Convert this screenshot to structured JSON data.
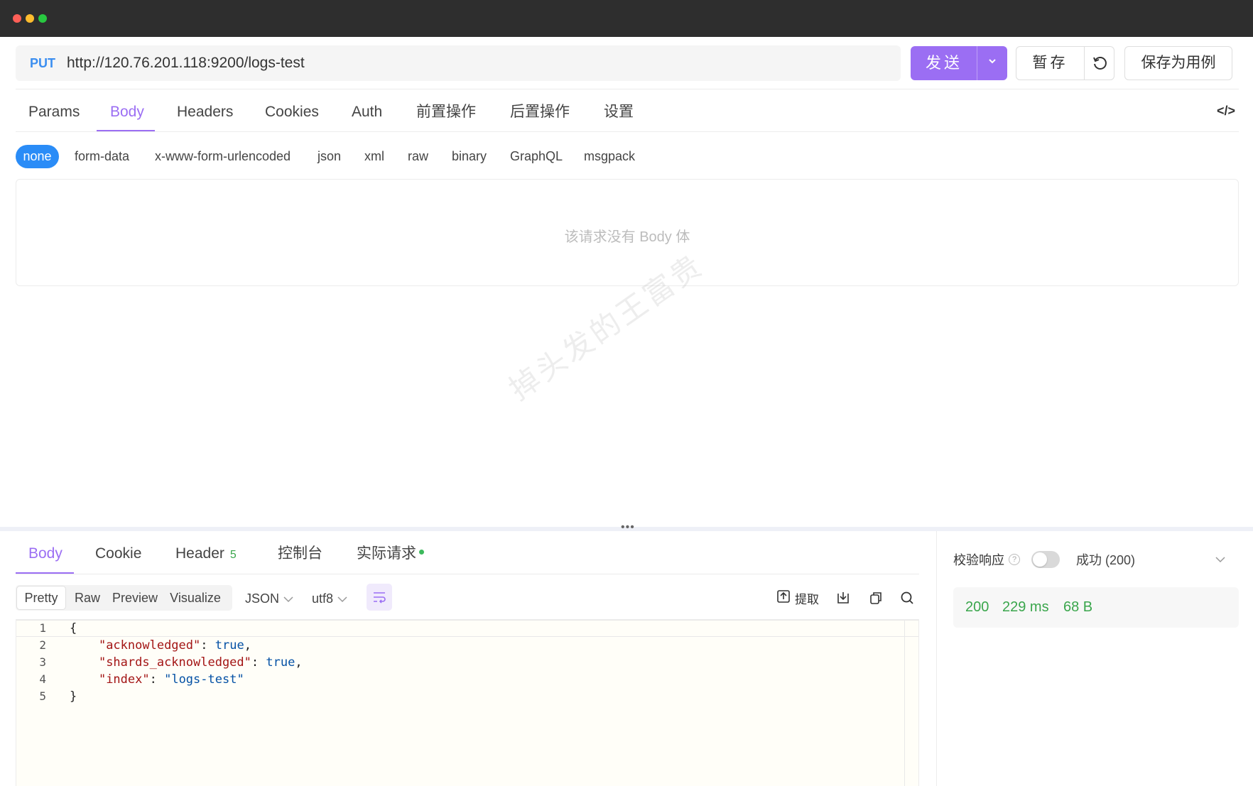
{
  "request": {
    "method": "PUT",
    "url": "http://120.76.201.118:9200/logs-test",
    "send_label": "发送",
    "save_temp_label": "暂存",
    "save_case_label": "保存为用例"
  },
  "request_tabs": [
    {
      "label": "Params"
    },
    {
      "label": "Body"
    },
    {
      "label": "Headers"
    },
    {
      "label": "Cookies"
    },
    {
      "label": "Auth"
    },
    {
      "label": "前置操作"
    },
    {
      "label": "后置操作"
    },
    {
      "label": "设置"
    }
  ],
  "code_icon": "</>",
  "body_types": [
    {
      "label": "none"
    },
    {
      "label": "form-data"
    },
    {
      "label": "x-www-form-urlencoded"
    },
    {
      "label": "json"
    },
    {
      "label": "xml"
    },
    {
      "label": "raw"
    },
    {
      "label": "binary"
    },
    {
      "label": "GraphQL"
    },
    {
      "label": "msgpack"
    }
  ],
  "body_empty_text": "该请求没有 Body 体",
  "watermark": "掉头发的王富贵",
  "splitter_handle": "•••",
  "response_tabs": [
    {
      "label": "Body"
    },
    {
      "label": "Cookie"
    },
    {
      "label": "Header",
      "badge": "5"
    },
    {
      "label": "控制台"
    },
    {
      "label": "实际请求"
    }
  ],
  "format_tabs": [
    {
      "label": "Pretty"
    },
    {
      "label": "Raw"
    },
    {
      "label": "Preview"
    },
    {
      "label": "Visualize"
    }
  ],
  "format_select": "JSON",
  "encoding_select": "utf8",
  "extract_label": "提取",
  "code": {
    "line_numbers": [
      "1",
      "2",
      "3",
      "4",
      "5"
    ],
    "open_brace": "{",
    "close_brace": "}",
    "lines": [
      {
        "key": "\"acknowledged\"",
        "value": "true",
        "trail": ","
      },
      {
        "key": "\"shards_acknowledged\"",
        "value": "true",
        "trail": ","
      },
      {
        "key": "\"index\"",
        "value": "\"logs-test\"",
        "trail": ""
      }
    ]
  },
  "verify": {
    "label": "校验响应",
    "help": "?",
    "enabled": false,
    "status_text": "成功 (200)"
  },
  "stats": {
    "status": "200",
    "time": "229 ms",
    "size": "68 B"
  },
  "colors": {
    "accent": "#9b6ef3",
    "none_active": "#2a8cf7",
    "success": "#3aa64c"
  }
}
